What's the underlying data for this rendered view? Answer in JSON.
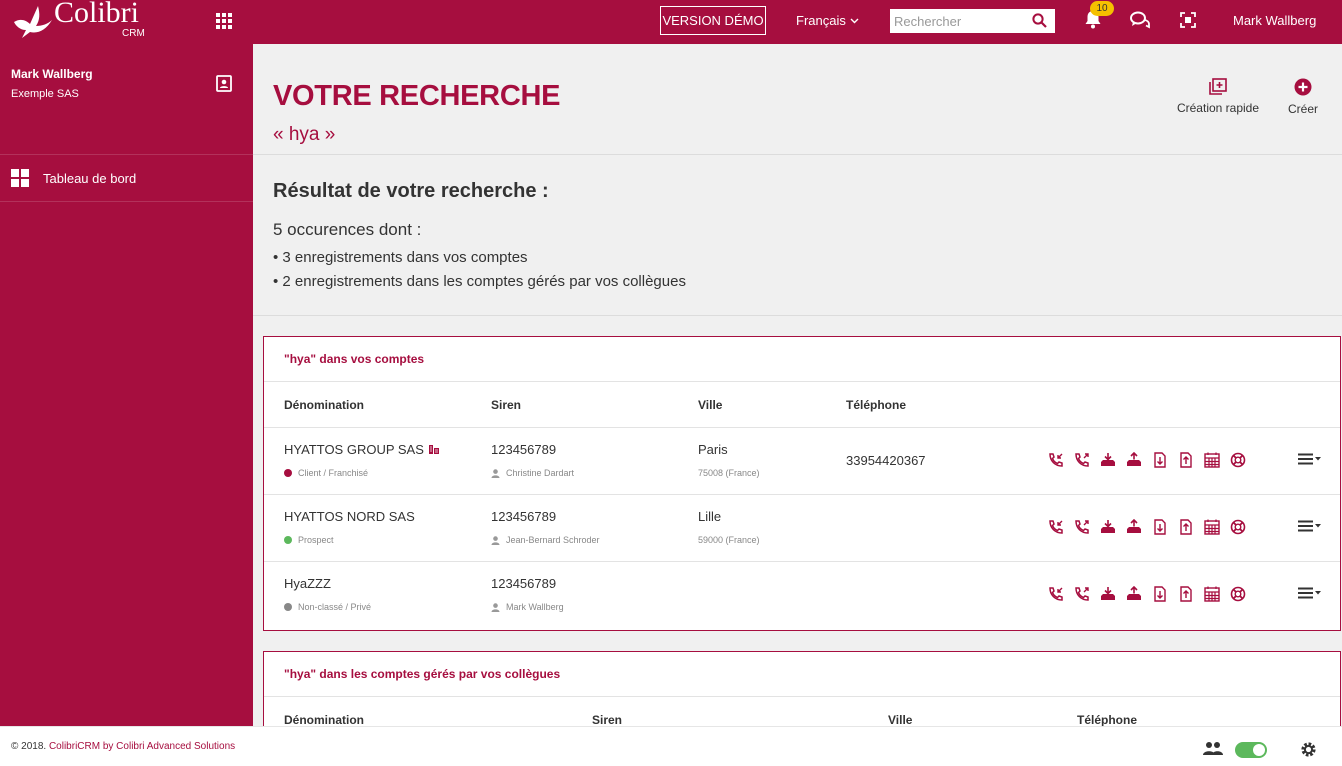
{
  "brand": {
    "name": "Colibri",
    "sub": "CRM"
  },
  "topbar": {
    "demo_label": "VERSION DÉMO",
    "language": "Français",
    "search_placeholder": "Rechercher",
    "notif_count": "10",
    "user": "Mark Wallberg"
  },
  "sidebar": {
    "user_name": "Mark Wallberg",
    "company": "Exemple SAS",
    "items": [
      {
        "label": "Tableau de bord"
      }
    ]
  },
  "header": {
    "title": "VOTRE RECHERCHE",
    "query": "« hya »",
    "quick_create": "Création rapide",
    "create": "Créer"
  },
  "results": {
    "title": "Résultat de votre recherche :",
    "count": "5 occurences dont :",
    "line1": "• 3 enregistrements dans vos comptes",
    "line2": "• 2 enregistrements dans les comptes gérés par vos collègues"
  },
  "panel1": {
    "title": "\"hya\" dans vos comptes",
    "columns": [
      "Dénomination",
      "Siren",
      "Ville",
      "Téléphone"
    ],
    "rows": [
      {
        "name": "HYATTOS GROUP SAS",
        "status": "Client / Franchisé",
        "status_color": "#a60e3f",
        "siren": "123456789",
        "owner": "Christine Dardart",
        "city": "Paris",
        "zip": "75008 (France)",
        "phone": "33954420367"
      },
      {
        "name": "HYATTOS NORD SAS",
        "status": "Prospect",
        "status_color": "#5cb85c",
        "siren": "123456789",
        "owner": "Jean-Bernard Schroder",
        "city": "Lille",
        "zip": "59000 (France)",
        "phone": ""
      },
      {
        "name": "HyaZZZ",
        "status": "Non-classé / Privé",
        "status_color": "#888888",
        "siren": "123456789",
        "owner": "Mark Wallberg",
        "city": "",
        "zip": "",
        "phone": ""
      }
    ]
  },
  "panel2": {
    "title": "\"hya\" dans les comptes gérés par vos collègues",
    "columns": [
      "Dénomination",
      "Siren",
      "Ville",
      "Téléphone"
    ]
  },
  "footer": {
    "copyright_prefix": "© 2018. ",
    "copyright_link": "ColibriCRM by Colibri Advanced Solutions"
  },
  "colors": {
    "brand": "#a60e3f",
    "toggle_on": "#5cb85c",
    "badge": "#f5c000"
  }
}
